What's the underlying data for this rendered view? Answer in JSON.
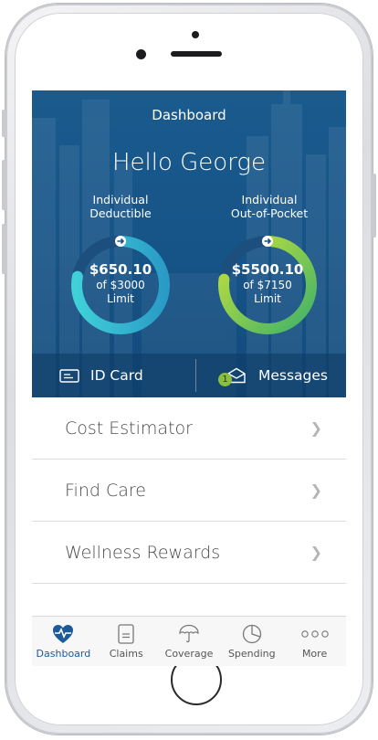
{
  "header": {
    "title": "Dashboard",
    "greeting": "Hello George"
  },
  "deductible": {
    "label_line1": "Individual",
    "label_line2": "Deductible",
    "amount": "$650.10",
    "of_text": "of $3000",
    "limit_text": "Limit",
    "progress": 0.78,
    "color_start": "#3fd0d8",
    "color_end": "#2a9bc6"
  },
  "out_of_pocket": {
    "label_line1": "Individual",
    "label_line2": "Out-of-Pocket",
    "amount": "$5500.10",
    "of_text": "of $7150",
    "limit_text": "Limit",
    "progress": 0.77,
    "color_start": "#c8e13a",
    "color_end": "#3fb26a"
  },
  "quick_actions": {
    "id_card_label": "ID Card",
    "messages_label": "Messages",
    "messages_badge": "1"
  },
  "menu": [
    {
      "label": "Cost Estimator"
    },
    {
      "label": "Find Care"
    },
    {
      "label": "Wellness Rewards"
    }
  ],
  "tabs": [
    {
      "label": "Dashboard",
      "icon": "heart-pulse-icon",
      "active": true
    },
    {
      "label": "Claims",
      "icon": "document-icon",
      "active": false
    },
    {
      "label": "Coverage",
      "icon": "umbrella-icon",
      "active": false
    },
    {
      "label": "Spending",
      "icon": "pie-chart-icon",
      "active": false
    },
    {
      "label": "More",
      "icon": "more-dots-icon",
      "active": false
    }
  ],
  "colors": {
    "hero_blue": "#175589",
    "accent_blue": "#1c5a9a",
    "badge_green": "#8cbf3f"
  }
}
